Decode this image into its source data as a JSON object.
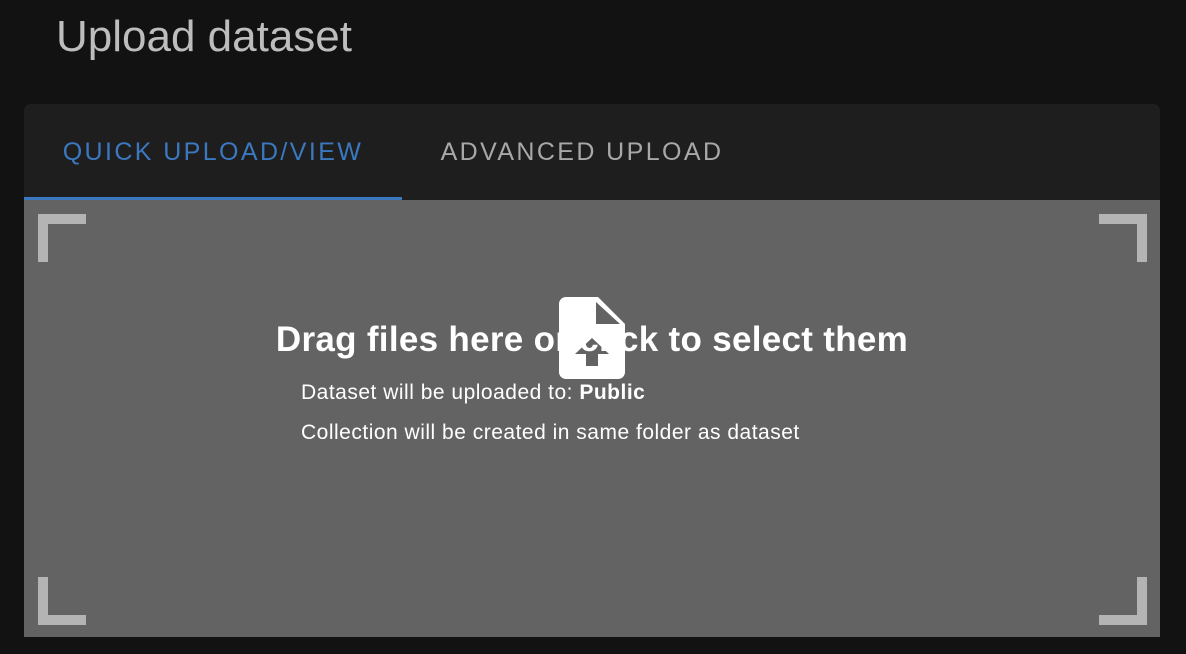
{
  "page": {
    "title": "Upload dataset"
  },
  "tabs": [
    {
      "label": "QUICK UPLOAD/VIEW",
      "active": true
    },
    {
      "label": "ADVANCED UPLOAD",
      "active": false
    }
  ],
  "dropzone": {
    "icon": "file-upload-icon",
    "headline": "Drag files here or click to select them",
    "destination_prefix": "Dataset will be uploaded to:",
    "destination": "Public",
    "collection_note": "Collection will be created in same folder as dataset"
  },
  "colors": {
    "accent": "#3a78c0",
    "background": "#121212",
    "card": "#1e1e1e",
    "dropzone": "#636363"
  }
}
